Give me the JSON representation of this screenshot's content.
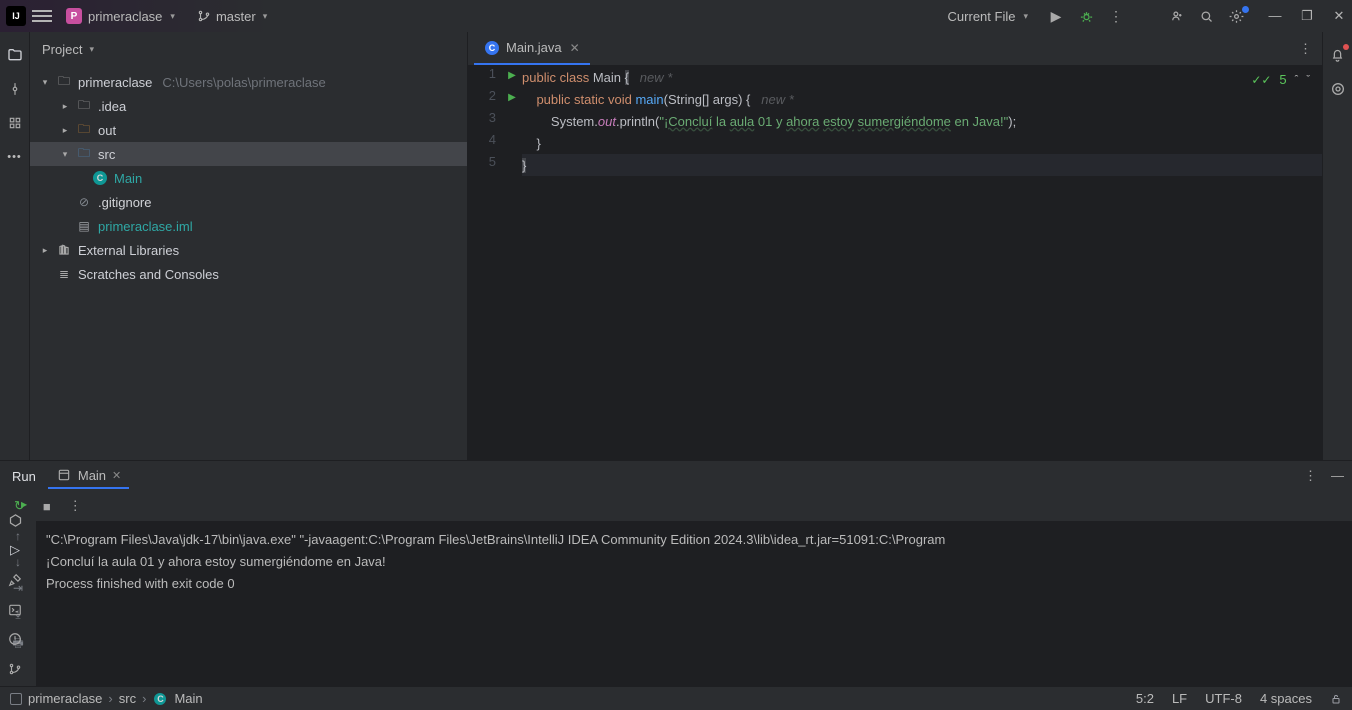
{
  "titlebar": {
    "project_name": "primeraclase",
    "branch": "master",
    "run_config": "Current File"
  },
  "project_panel": {
    "title": "Project",
    "root": "primeraclase",
    "root_path": "C:\\Users\\polas\\primeraclase",
    "items": {
      "idea": ".idea",
      "out": "out",
      "src": "src",
      "main": "Main",
      "gitignore": ".gitignore",
      "iml": "primeraclase.iml",
      "external": "External Libraries",
      "scratches": "Scratches and Consoles"
    }
  },
  "editor": {
    "tab_name": "Main.java",
    "hint1": "new *",
    "hint2": "new *",
    "inspections": "5",
    "code": {
      "l1": {
        "a": "public ",
        "b": "class ",
        "c": "Main ",
        "d": "{"
      },
      "l2": {
        "indent": "    ",
        "a": "public static ",
        "b": "void ",
        "c": "main",
        "d": "(",
        "e": "String",
        "f": "[] args) {"
      },
      "l3": {
        "indent": "        ",
        "a": "System.",
        "b": "out",
        "c": ".println(",
        "d": "\"",
        "e": "¡Concluí",
        "f": " la ",
        "g": "aula",
        "h": " 01 y ",
        "i": "ahora",
        "j": " ",
        "k": "estoy",
        "l": " ",
        "m": "sumergiéndome",
        "n": " en Java!\"",
        "o": ");"
      },
      "l4": {
        "indent": "    ",
        "a": "}"
      },
      "l5": {
        "a": "}"
      }
    }
  },
  "run_panel": {
    "title": "Run",
    "tab": "Main",
    "console_lines": [
      "\"C:\\Program Files\\Java\\jdk-17\\bin\\java.exe\" \"-javaagent:C:\\Program Files\\JetBrains\\IntelliJ IDEA Community Edition 2024.3\\lib\\idea_rt.jar=51091:C:\\Program",
      "¡Concluí la aula 01 y ahora estoy sumergiéndome en Java!",
      "",
      "Process finished with exit code 0"
    ]
  },
  "statusbar": {
    "crumbs": [
      "primeraclase",
      "src",
      "Main"
    ],
    "pos": "5:2",
    "line_sep": "LF",
    "encoding": "UTF-8",
    "indent": "4 spaces"
  }
}
